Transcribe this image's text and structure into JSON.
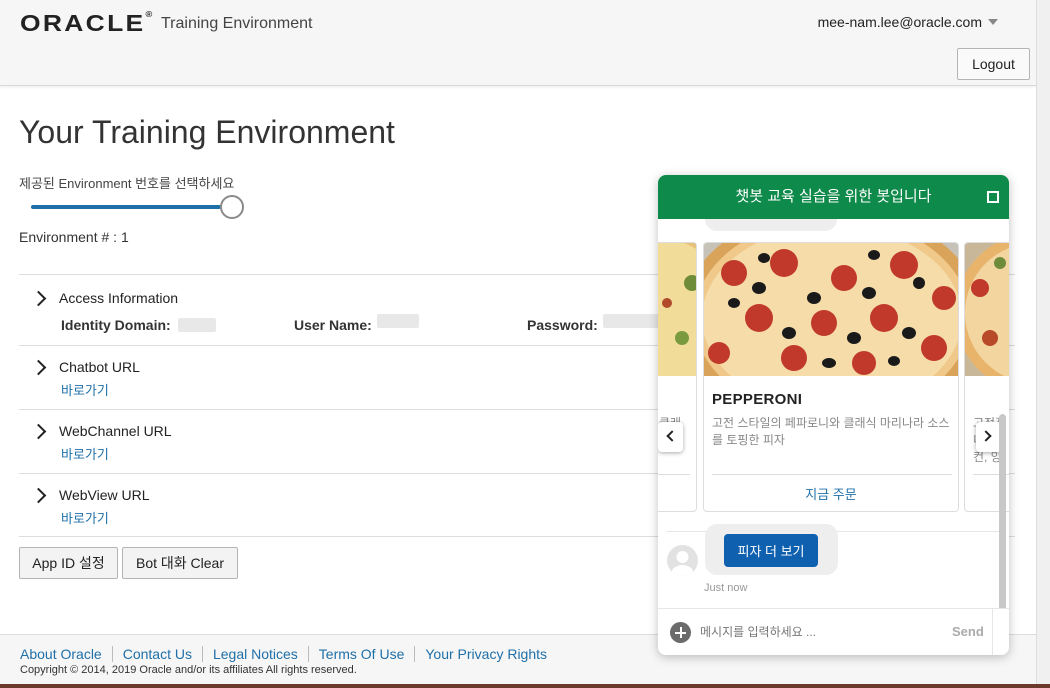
{
  "header": {
    "logo": "ORACLE",
    "subtitle": "Training Environment",
    "user_email": "mee-nam.lee@oracle.com",
    "logout_label": "Logout"
  },
  "main": {
    "title": "Your Training Environment",
    "slider_label": "제공된 Environment 번호를 선택하세요",
    "slider_level": 1.0,
    "env_label": "Environment # : 1",
    "sections": [
      {
        "title": "Access Information",
        "fields": [
          {
            "label": "Identity Domain: "
          },
          {
            "label": "User Name: "
          },
          {
            "label": "Password: "
          }
        ]
      },
      {
        "title": "Chatbot URL",
        "link": "바로가기"
      },
      {
        "title": "WebChannel URL",
        "link": "바로가기"
      },
      {
        "title": "WebView URL",
        "link": "바로가기"
      }
    ],
    "buttons": {
      "app_id": "App ID 설정",
      "bot_clear": "Bot 대화 Clear"
    }
  },
  "footer": {
    "links": [
      "About Oracle",
      "Contact Us",
      "Legal Notices",
      "Terms Of Use",
      "Your Privacy Rights"
    ],
    "copyright": "Copyright © 2014, 2019 Oracle and/or its affiliates All rights reserved."
  },
  "chat": {
    "header_title": "챗봇 교육 실습을 위한 봇입니다",
    "card": {
      "title": "PEPPERONI",
      "description": "고전 스타일의 페파로니와 클래식 마리나라 소스를 토핑한 피자",
      "action": "지금 주문"
    },
    "left_card_desc": "클래",
    "right_card_desc": "고전적\n니, 지\n컨, 양",
    "more_button": "피자 더 보기",
    "timestamp": "Just now",
    "input_placeholder": "메시지를 입력하세요 ...",
    "send_label": "Send"
  },
  "colors": {
    "accent": "#1f6fa8",
    "chat_header": "#0e8a4a",
    "chat_button": "#1060b0"
  },
  "icons": [
    "chevron-right-icon",
    "caret-down-icon",
    "maximize-icon",
    "plus-circle-icon",
    "chevron-left-icon",
    "avatar-icon"
  ]
}
